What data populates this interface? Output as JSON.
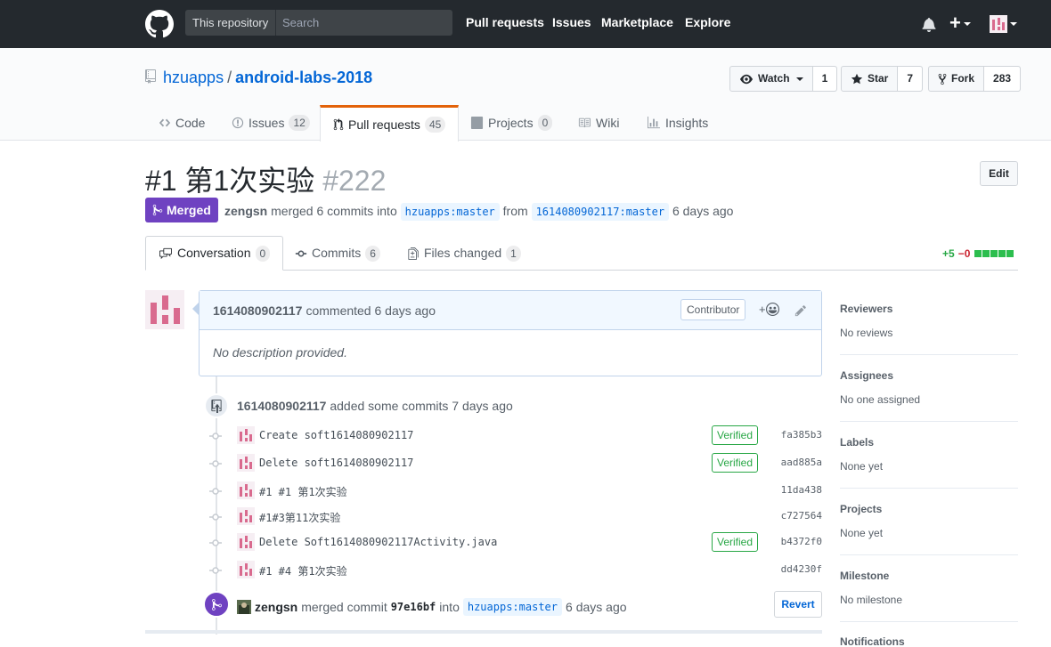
{
  "header": {
    "scope_label": "This repository",
    "search_placeholder": "Search",
    "nav": [
      "Pull requests",
      "Issues",
      "Marketplace",
      "Explore"
    ]
  },
  "repo": {
    "owner": "hzuapps",
    "name": "android-labs-2018",
    "watch_label": "Watch",
    "watch_count": "1",
    "star_label": "Star",
    "star_count": "7",
    "fork_label": "Fork",
    "fork_count": "283"
  },
  "reponav": {
    "code": "Code",
    "issues": "Issues",
    "issues_count": "12",
    "pulls": "Pull requests",
    "pulls_count": "45",
    "projects": "Projects",
    "projects_count": "0",
    "wiki": "Wiki",
    "insights": "Insights"
  },
  "pr": {
    "title": "#1 第1次实验",
    "number": "#222",
    "edit_label": "Edit",
    "state": "Merged",
    "author": "zengsn",
    "merged_text": "merged 6 commits into",
    "base_branch": "hzuapps:master",
    "from_text": "from",
    "head_branch": "1614080902117:master",
    "time": "6 days ago"
  },
  "tabs": {
    "conversation": "Conversation",
    "conversation_count": "0",
    "commits": "Commits",
    "commits_count": "6",
    "files": "Files changed",
    "files_count": "1"
  },
  "diffstat": {
    "additions": "+5",
    "deletions": "−0"
  },
  "comment": {
    "author": "1614080902117",
    "action": "commented 6 days ago",
    "role": "Contributor",
    "reaction": "+",
    "body": "No description provided."
  },
  "commits_event": {
    "author": "1614080902117",
    "action": "added some commits 7 days ago",
    "items": [
      {
        "message": "Create soft1614080902117",
        "verified": "Verified",
        "sha": "fa385b3"
      },
      {
        "message": "Delete soft1614080902117",
        "verified": "Verified",
        "sha": "aad885a"
      },
      {
        "message": "#1 #1 第1次实验",
        "verified": "",
        "sha": "11da438"
      },
      {
        "message": "#1#3第11次实验",
        "verified": "",
        "sha": "c727564"
      },
      {
        "message": "Delete Soft1614080902117Activity.java",
        "verified": "Verified",
        "sha": "b4372f0"
      },
      {
        "message": "#1 #4 第1次实验",
        "verified": "",
        "sha": "dd4230f"
      }
    ]
  },
  "merge_event": {
    "author": "zengsn",
    "action": "merged commit",
    "sha": "97e16bf",
    "into": "into",
    "branch": "hzuapps:master",
    "time": "6 days ago",
    "revert_label": "Revert"
  },
  "sidebar": {
    "reviewers_label": "Reviewers",
    "reviewers_value": "No reviews",
    "assignees_label": "Assignees",
    "assignees_value": "No one assigned",
    "labels_label": "Labels",
    "labels_value": "None yet",
    "projects_label": "Projects",
    "projects_value": "None yet",
    "milestone_label": "Milestone",
    "milestone_value": "No milestone",
    "notifications_label": "Notifications"
  },
  "colors": {
    "header_bg": "#24292e",
    "merged": "#6f42c1",
    "link": "#0366d6",
    "verified": "#28a745",
    "accent_tab": "#e36209"
  }
}
